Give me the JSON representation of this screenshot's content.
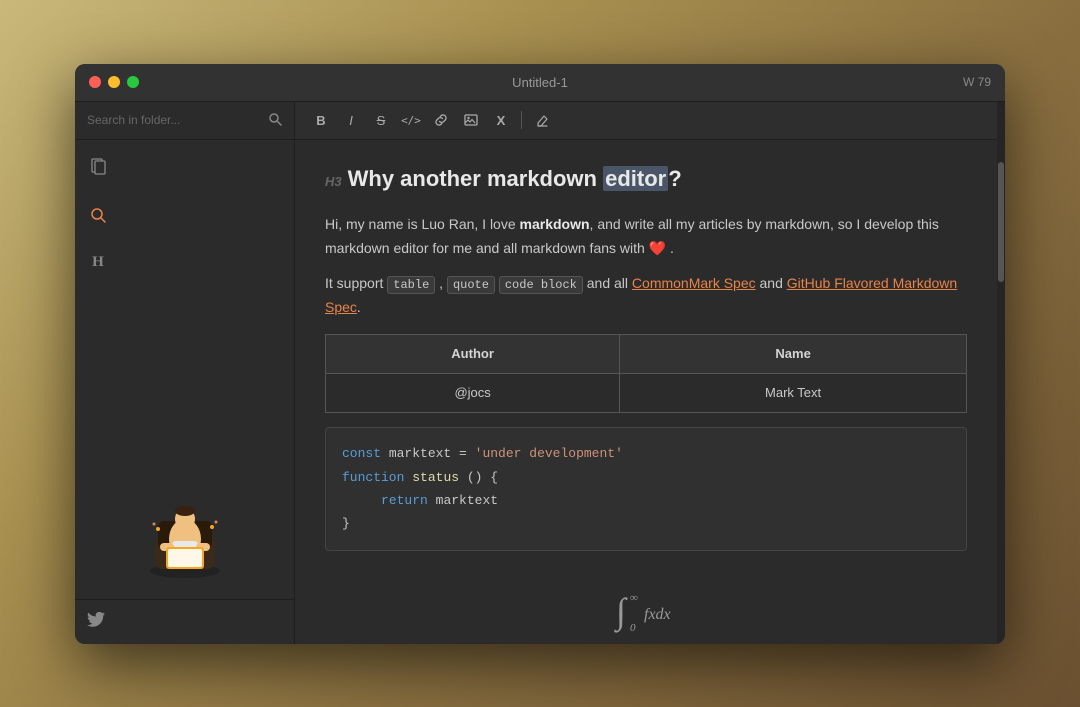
{
  "window": {
    "title": "Untitled-1",
    "word_count": "W 79",
    "traffic_lights": [
      "red",
      "yellow",
      "green"
    ]
  },
  "sidebar": {
    "search_placeholder": "Search in folder...",
    "icons": [
      {
        "name": "file",
        "symbol": "🗋",
        "active": false
      },
      {
        "name": "search",
        "symbol": "🔍",
        "active": true
      },
      {
        "name": "heading",
        "symbol": "H",
        "active": false
      }
    ],
    "twitter_label": "🐦"
  },
  "toolbar": {
    "buttons": [
      {
        "label": "B",
        "name": "bold"
      },
      {
        "label": "I",
        "name": "italic"
      },
      {
        "label": "S̶",
        "name": "strikethrough"
      },
      {
        "label": "</>",
        "name": "code"
      },
      {
        "label": "🔗",
        "name": "link"
      },
      {
        "label": "🖼",
        "name": "image"
      },
      {
        "label": "X",
        "name": "remove"
      },
      {
        "label": "✎",
        "name": "eraser"
      }
    ]
  },
  "editor": {
    "heading_prefix": "H3",
    "heading": "Why another markdown editor?",
    "heading_highlighted_word": "editor",
    "paragraph1_pre": "Hi, my name is Luo Ran, I love ",
    "paragraph1_bold": "markdown",
    "paragraph1_post": ", and write all my articles by markdown, so I develop this markdown editor for me and all markdown fans with ❤️ .",
    "paragraph2_pre": "It support ",
    "paragraph2_code1": "table",
    "paragraph2_code2": "quote",
    "paragraph2_code3": "code block",
    "paragraph2_mid": " and all ",
    "paragraph2_link1": "CommonMark Spec",
    "paragraph2_and": " and ",
    "paragraph2_link2": "GitHub Flavored Markdown Spec",
    "paragraph2_post": ".",
    "table": {
      "headers": [
        "Author",
        "Name"
      ],
      "rows": [
        [
          "@jocs",
          "Mark Text"
        ]
      ]
    },
    "code_block": {
      "lines": [
        {
          "type": "code",
          "content": "const marktext = 'under development'"
        },
        {
          "type": "code",
          "content": "function status () {"
        },
        {
          "type": "code",
          "content": "    return marktext"
        },
        {
          "type": "code",
          "content": "}"
        }
      ]
    },
    "math": "∫₀^∞ fxdx"
  }
}
